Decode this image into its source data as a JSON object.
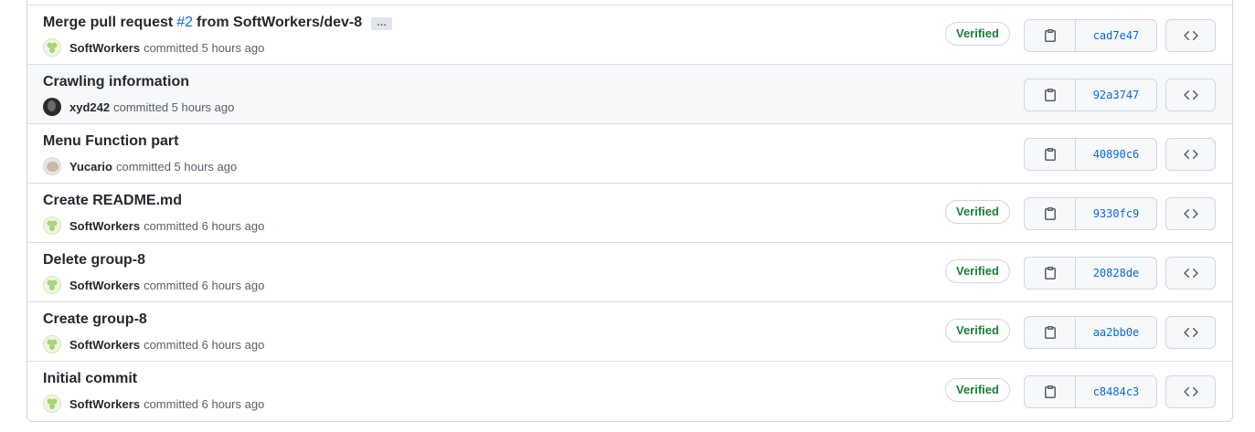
{
  "commits": [
    {
      "message_pre": "Merge pull request",
      "pr_link": "#2",
      "message_post": "from SoftWorkers/dev-8",
      "ellipsis": "…",
      "author": "SoftWorkers",
      "committed": "committed 5 hours ago",
      "verified": "Verified",
      "sha": "cad7e47",
      "avatar": "softworkers"
    },
    {
      "message": "Crawling information",
      "author": "xyd242",
      "committed": "committed 5 hours ago",
      "sha": "92a3747",
      "avatar": "xyd"
    },
    {
      "message": "Menu Function part",
      "author": "Yucario",
      "committed": "committed 5 hours ago",
      "sha": "40890c6",
      "avatar": "yucario"
    },
    {
      "message": "Create README.md",
      "author": "SoftWorkers",
      "committed": "committed 6 hours ago",
      "verified": "Verified",
      "sha": "9330fc9",
      "avatar": "softworkers"
    },
    {
      "message": "Delete group-8",
      "author": "SoftWorkers",
      "committed": "committed 6 hours ago",
      "verified": "Verified",
      "sha": "20828de",
      "avatar": "softworkers"
    },
    {
      "message": "Create group-8",
      "author": "SoftWorkers",
      "committed": "committed 6 hours ago",
      "verified": "Verified",
      "sha": "aa2bb0e",
      "avatar": "softworkers"
    },
    {
      "message": "Initial commit",
      "author": "SoftWorkers",
      "committed": "committed 6 hours ago",
      "verified": "Verified",
      "sha": "c8484c3",
      "avatar": "softworkers"
    }
  ],
  "icons": {
    "copy": "clipboard-icon",
    "browse": "code-icon"
  },
  "colors": {
    "link": "#0969da",
    "verified": "#1a7f37",
    "border": "#d0d7de",
    "hover_row": "#f6f8fa"
  }
}
